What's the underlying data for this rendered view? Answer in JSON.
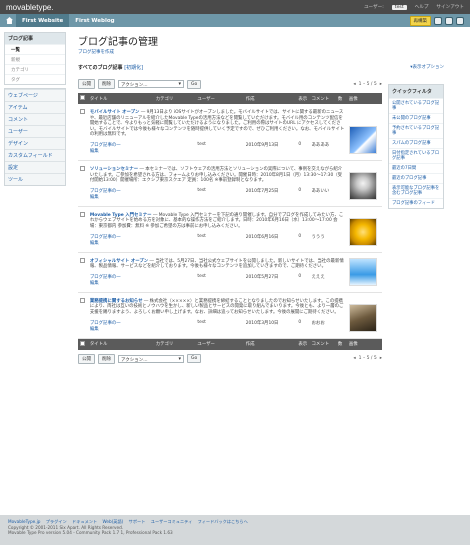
{
  "topbar": {
    "logo": "movabletype",
    "logo_suffix": ".",
    "user_label": "ユーザー:",
    "username": "test",
    "help": "ヘルプ",
    "signout": "サインアウト"
  },
  "nav": {
    "website": "First Website",
    "blog": "First Weblog",
    "publish": "再構築"
  },
  "sidebar": {
    "blog_posts": {
      "title": "ブログ記事",
      "items": [
        "一覧",
        "新規",
        "カテゴリ",
        "タグ"
      ]
    },
    "groups": [
      "ウェブページ",
      "アイテム",
      "コメント",
      "ユーザー",
      "デザイン",
      "カスタムフィールド",
      "設定",
      "ツール"
    ]
  },
  "main": {
    "title": "ブログ記事の管理",
    "new_link": "ブログ記事を作成",
    "subtitle": "すべてのブログ記事",
    "reset": "[初期化]",
    "buttons": {
      "publish": "公開",
      "delete": "削除",
      "action": "アクション...",
      "go": "Go"
    },
    "pager": "1 – 5 / 5",
    "columns": [
      "",
      "タイトル",
      "カテゴリ",
      "ユーザー",
      "作成",
      "表示",
      "コメント",
      "数",
      "画像"
    ],
    "entries": [
      {
        "title": "モバイルサイト オープン",
        "excerpt": "― 9月13日より iOSサイトがオープンしました。モバイルサイトでは、サイトに関する最新のニュースや、最近店舗のリニューアルを紹介したMovable Typeの活用方法などを閲覧していただけます。モバイル用のコンテンツ配信を開始することで、今よりもっと気軽に閲覧していただけるようになりました。ご利用の際はサイトのURL にアクセスしてください。モバイルサイトでは今後も様々なコンテンツを随時提供していく予定ですので、ぜひご利用ください。なお、モバイルサイトの利用は無料です。",
        "category": "ブログ記事の一",
        "edit": "編集",
        "user": "test",
        "date": "2010年9月13日",
        "views": "0",
        "comments": "ああああ"
      },
      {
        "title": "ソリューションセミナー",
        "excerpt": "― 本セミナーでは、ソフトウェアの活用方法とソリューションの実際について、事例を交えながら紹介いたします。ご参加を希望される方は、フォームよりお申し込みください。開催日時：2010年8月1日（月）13:30～17:30（受付開始13:00）開催場所：エクシブ東京スクエア 定員：100名 ※事前登録制となります。",
        "category": "ブログ記事の一",
        "edit": "編集",
        "user": "test",
        "date": "2010年7月25日",
        "views": "0",
        "comments": "ああいい"
      },
      {
        "title": "Movable Type 入門セミナー",
        "excerpt": "― Movable Type 入門セミナーを下記の通り開催します。自分でブログを作成してみたい方、これからウェブサイトを始める方を対象に、基本的な操作方法をご紹介します。日時：2010年6月16日（水）13:00～17:00 会場：東京都内 参加費：無料 ※ 参加ご希望の方は事前にお申し込みください。",
        "category": "ブログ記事の一",
        "edit": "編集",
        "user": "test",
        "date": "2010年6月16日",
        "views": "0",
        "comments": "ううう"
      },
      {
        "title": "オフィシャルサイト オープン",
        "excerpt": "― 当社では、5月27日、当社公式ウェブサイトを公開しました。新しいサイトでは、当社の最新情報、製品情報、サービスなどを紹介しております。今後も様々なコンテンツを追加していきますので、ご期待ください。",
        "category": "ブログ記事の一",
        "edit": "編集",
        "user": "test",
        "date": "2010年5月27日",
        "views": "0",
        "comments": "えええ"
      },
      {
        "title": "業務提携に関するお知らせ",
        "excerpt": "― 株式会社（×××××）と業務提携を締結することとなりましたのでお知らせいたします。この提携により、両社は互いの技術とノウハウを生かし、新しい製品とサービスの開発に取り組んでまいります。今後とも、より一層のご支援を賜りますよう、よろしくお願い申し上げます。なお、詳細は追ってお知らせいたします。今後の展開にご期待ください。",
        "category": "ブログ記事の一",
        "edit": "編集",
        "user": "test",
        "date": "2010年3月10日",
        "views": "0",
        "comments": "おおお"
      }
    ]
  },
  "right": {
    "display_options": "▾表示オプション",
    "quick_filter_title": "クイックフィルタ",
    "filters": [
      "公開されているブログ記事",
      "未公開のブログ記事",
      "予約されているブログ記事",
      "スパムのブログ記事",
      "日付指定されているブログ記事",
      "最近の7日間",
      "最近のブログ記事",
      "表示可能なブログ記事を含むブログ記事",
      "ブログ記事のフィード"
    ]
  },
  "footer": {
    "links": [
      "MovableType.jp",
      "プラグイン",
      "ドキュメント",
      "Web(英語)",
      "サポート",
      "ユーザーコミュニティ",
      "フィードバックはこちらへ"
    ],
    "copyright": "Copyright © 2001-2011 Six Apart. All Rights Reserved.",
    "version": "Movable Type Pro version 5.04 - Community Pack 1.7 1, Professional Pack 1.63"
  }
}
